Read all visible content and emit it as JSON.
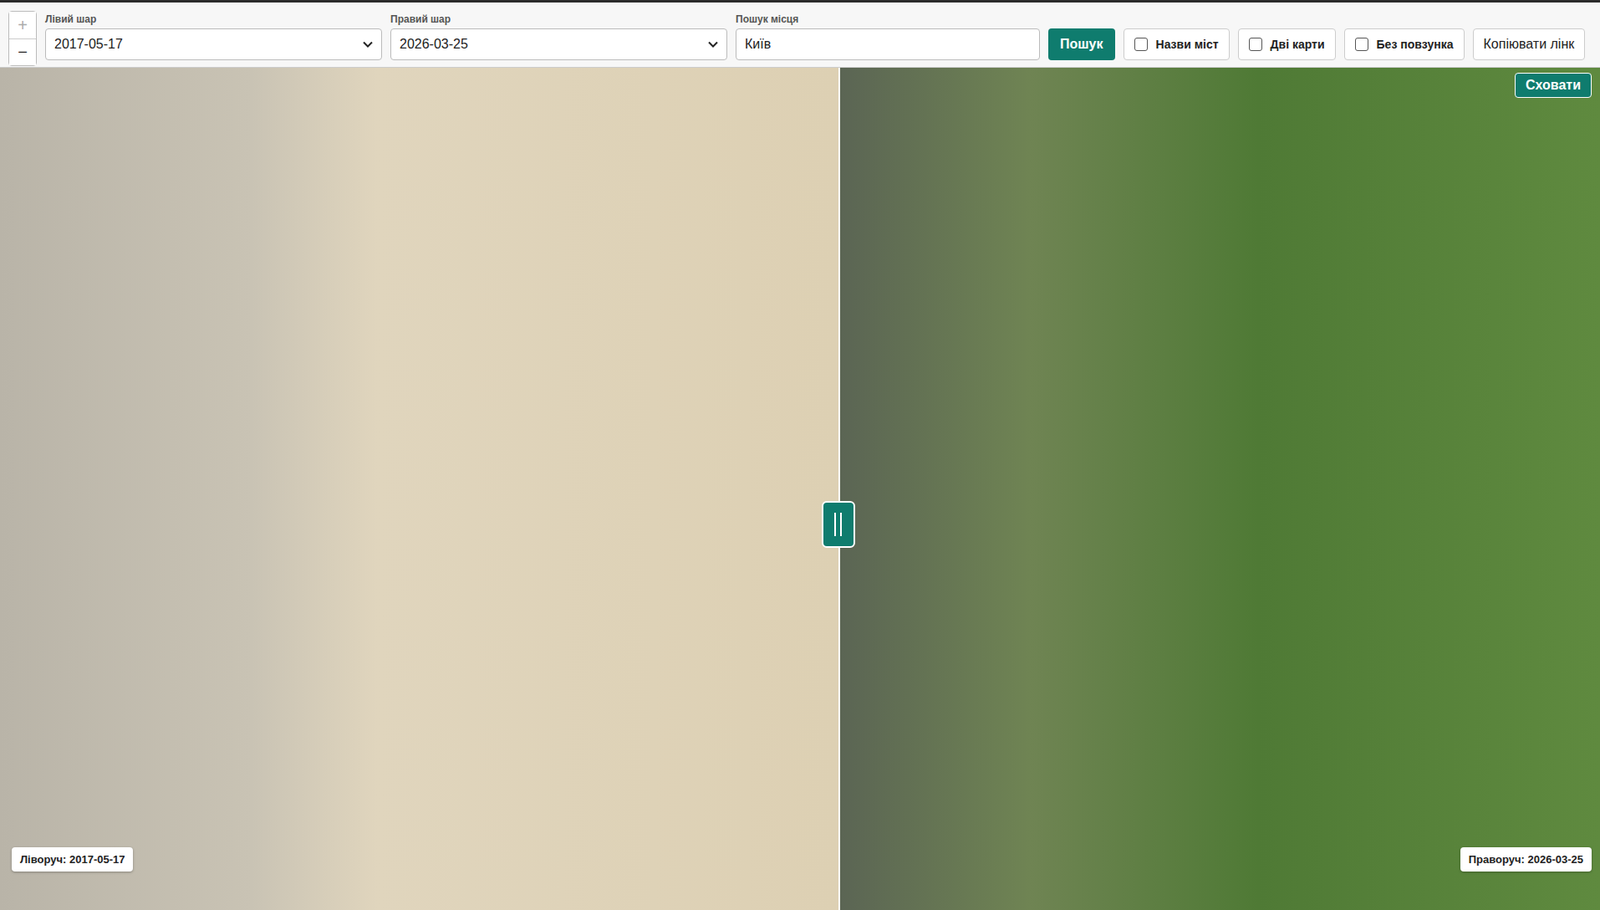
{
  "zoom": {
    "in": {
      "label": "+",
      "disabled": true
    },
    "out": {
      "label": "−",
      "disabled": false
    }
  },
  "layers": [
    {
      "label": "Лівий шар",
      "value": "2017-05-17"
    },
    {
      "label": "Правий шар",
      "value": "2026-03-25"
    }
  ],
  "search": {
    "label": "Пошук місця",
    "value": "Київ",
    "button": "Пошук"
  },
  "toggles": [
    {
      "label": "Назви міст",
      "checked": false
    },
    {
      "label": "Дві карти",
      "checked": false
    },
    {
      "label": "Без повзунка",
      "checked": false
    }
  ],
  "copy_button": "Копіювати лінк",
  "map": {
    "hide_button": "Сховати",
    "left_caption": "Ліворуч: 2017-05-17",
    "right_caption": "Праворуч: 2026-03-25",
    "split": {
      "level": 0.524
    }
  }
}
